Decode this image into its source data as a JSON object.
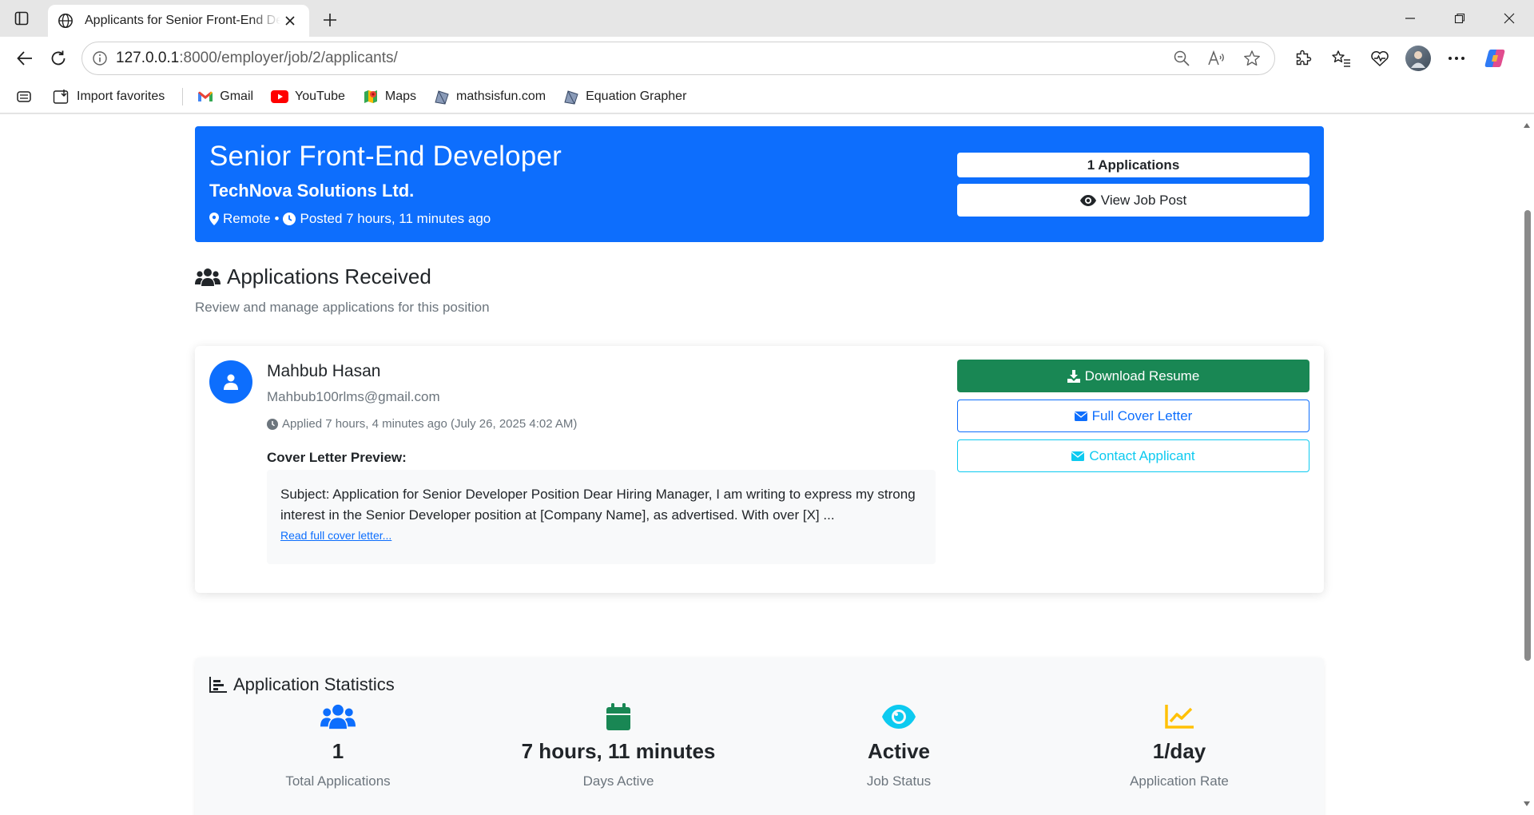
{
  "browser": {
    "tab_title": "Applicants for Senior Front-End Developer",
    "url_host": "127.0.0.1",
    "url_path": ":8000/employer/job/2/applicants/",
    "favorites": [
      {
        "label": "Import favorites",
        "icon": "import-icon"
      },
      {
        "label": "Gmail",
        "icon": "gmail-icon"
      },
      {
        "label": "YouTube",
        "icon": "youtube-icon"
      },
      {
        "label": "Maps",
        "icon": "maps-icon"
      },
      {
        "label": "mathsisfun.com",
        "icon": "site-icon"
      },
      {
        "label": "Equation Grapher",
        "icon": "site-icon"
      }
    ]
  },
  "job": {
    "title": "Senior Front-End Developer",
    "company": "TechNova Solutions Ltd.",
    "location": "Remote",
    "separator": "•",
    "posted": "Posted 7 hours, 11 minutes ago",
    "applications_badge": "1 Applications",
    "view_post_label": "View Job Post"
  },
  "section": {
    "title": "Applications Received",
    "subtitle": "Review and manage applications for this position"
  },
  "applicant": {
    "name": "Mahbub Hasan",
    "email": "Mahbub100rlms@gmail.com",
    "applied": "Applied 7 hours, 4 minutes ago (July 26, 2025 4:02 AM)",
    "cover_letter_heading": "Cover Letter Preview:",
    "cover_letter_preview": "Subject: Application for Senior Developer Position Dear Hiring Manager, I am writing to express my strong interest in the Senior Developer position at [Company Name], as advertised. With over [X] ...",
    "read_full_link": "Read full cover letter...",
    "download_resume_label": "Download Resume",
    "full_cover_letter_label": "Full Cover Letter",
    "contact_label": "Contact Applicant"
  },
  "stats": {
    "title": "Application Statistics",
    "items": [
      {
        "value": "1",
        "label": "Total Applications",
        "icon": "users-icon",
        "color": "#0d6efd"
      },
      {
        "value": "7 hours, 11 minutes",
        "label": "Days Active",
        "icon": "calendar-icon",
        "color": "#198754"
      },
      {
        "value": "Active",
        "label": "Job Status",
        "icon": "eye-icon",
        "color": "#0dcaf0"
      },
      {
        "value": "1/day",
        "label": "Application Rate",
        "icon": "chart-line-icon",
        "color": "#ffc107"
      }
    ]
  },
  "colors": {
    "primary": "#0d6efd",
    "success": "#198754",
    "info": "#0dcaf0",
    "warning": "#ffc107"
  }
}
